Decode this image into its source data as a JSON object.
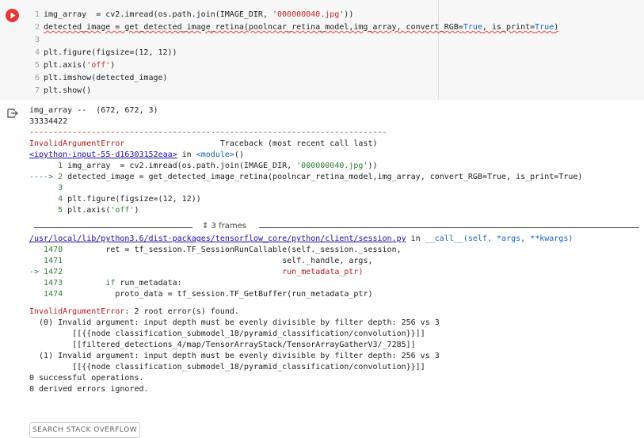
{
  "code_cell": {
    "lines": [
      {
        "num": "1",
        "segments": [
          {
            "t": "img_array  = cv2.imread(os.path.join(IMAGE_DIR, "
          },
          {
            "t": "'000000040.jpg'",
            "c": "str"
          },
          {
            "t": "))"
          }
        ]
      },
      {
        "num": "2",
        "segments": [
          {
            "t": "detected_image = get_detected_image_retina(poolncar_retina_model,img_array, convert_RGB=",
            "u": 1
          },
          {
            "t": "True",
            "c": "kw",
            "u": 1
          },
          {
            "t": ", is_print=",
            "u": 1
          },
          {
            "t": "True",
            "c": "kw",
            "u": 1
          },
          {
            "t": ")",
            "u": 1
          }
        ]
      },
      {
        "num": "3",
        "segments": [
          {
            "t": ""
          }
        ]
      },
      {
        "num": "4",
        "segments": [
          {
            "t": "plt.figure(figsize=(12, 12))"
          }
        ]
      },
      {
        "num": "5",
        "segments": [
          {
            "t": "plt.axis("
          },
          {
            "t": "'off'",
            "c": "str"
          },
          {
            "t": ")"
          }
        ]
      },
      {
        "num": "6",
        "segments": [
          {
            "t": "plt.imshow(detected_image)"
          }
        ]
      },
      {
        "num": "7",
        "segments": [
          {
            "t": "plt.show()"
          }
        ]
      }
    ]
  },
  "output": {
    "pre_lines": [
      "img_array --  (672, 672, 3)",
      "33334422"
    ],
    "dash_line": "---------------------------------------------------------------------------",
    "error_header": {
      "name": "InvalidArgumentError",
      "traceback": "                    Traceback (most recent call last)"
    },
    "input_link": "<ipython-input-55-d16303152eaa>",
    "in_text": " in ",
    "module_text": "<module>",
    "module_tail": "()",
    "trace1": [
      {
        "prefix": "      1 ",
        "segments": [
          {
            "t": "img_array  = cv2.imread(os.path.join(IMAGE_DIR, "
          },
          {
            "t": "'000000040.jpg'",
            "c": "green"
          },
          {
            "t": "))"
          }
        ]
      },
      {
        "prefix": "----> 2 ",
        "arrow": 1,
        "segments": [
          {
            "t": "detected_image = get_detected_image_retina(poolncar_retina_model,img_array, convert_RGB=True, is_print=True)"
          }
        ]
      },
      {
        "prefix": "      3",
        "segments": [
          {
            "t": ""
          }
        ]
      },
      {
        "prefix": "      4 ",
        "segments": [
          {
            "t": "plt.figure(figsize=(12, 12))"
          }
        ]
      },
      {
        "prefix": "      5 ",
        "segments": [
          {
            "t": "plt.axis("
          },
          {
            "t": "'off'",
            "c": "green"
          },
          {
            "t": ")"
          }
        ]
      }
    ],
    "frames_label": "3 frames",
    "session_link": "/usr/local/lib/python3.6/dist-packages/tensorflow_core/python/client/session.py",
    "call_text": "__call__",
    "call_args": "(self, *args, **kwargs)",
    "trace2": [
      {
        "prefix": "   1470 ",
        "segments": [
          {
            "t": "        ret = tf_session.TF_SessionRunCallable(self._session._session,"
          }
        ]
      },
      {
        "prefix": "   1471 ",
        "segments": [
          {
            "t": "                                             self._handle, args,"
          }
        ]
      },
      {
        "prefix": "-> 1472 ",
        "arrow": 1,
        "segments": [
          {
            "t": "                                             "
          },
          {
            "t": "run_metadata_ptr)",
            "c": "red"
          }
        ]
      },
      {
        "prefix": "   1473 ",
        "segments": [
          {
            "t": "        "
          },
          {
            "t": "if",
            "c": "green"
          },
          {
            "t": " run_metadata:"
          }
        ]
      },
      {
        "prefix": "   1474 ",
        "segments": [
          {
            "t": "          proto_data = tf_session.TF_GetBuffer(run_metadata_ptr)"
          }
        ]
      }
    ],
    "final_error_name": "InvalidArgumentError",
    "final_error_msg": ": 2 root error(s) found.",
    "detail_lines": [
      "  (0) Invalid argument: input depth must be evenly divisible by filter depth: 256 vs 3",
      "\t [[{{node classification_submodel_18/pyramid_classification/convolution}}]]",
      "\t [[filtered_detections_4/map/TensorArrayStack/TensorArrayGatherV3/_7285]]",
      "  (1) Invalid argument: input depth must be evenly divisible by filter depth: 256 vs 3",
      "\t [[{{node classification_submodel_18/pyramid_classification/convolution}}]]",
      "0 successful operations.",
      "0 derived errors ignored."
    ],
    "search_button": "SEARCH STACK OVERFLOW"
  },
  "colors": {
    "run_button": "#e53935",
    "error": "#b71c1c",
    "link": "#1a0dab"
  },
  "icons": {
    "run": "play-circle-icon",
    "output": "output-arrow-icon",
    "frames": "chevron-updown-icon"
  }
}
